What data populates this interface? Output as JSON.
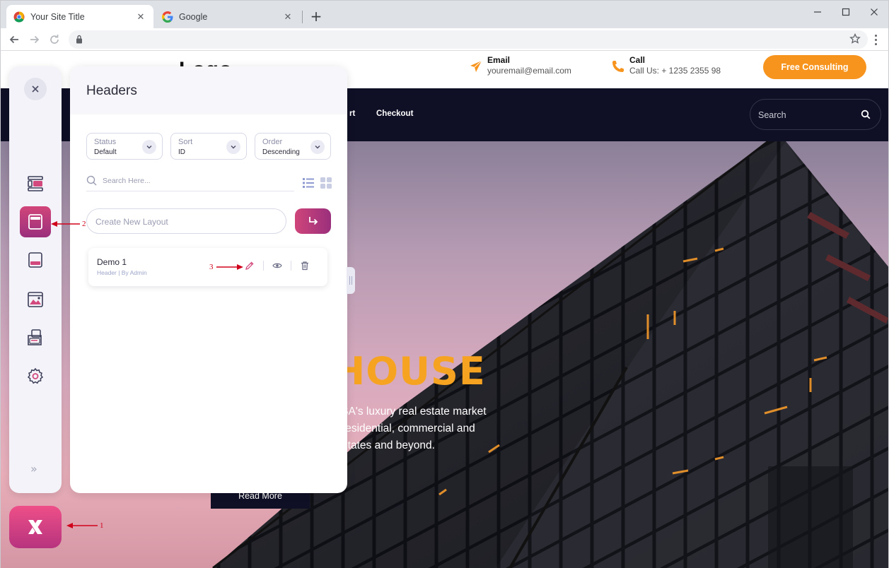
{
  "browser": {
    "tabs": [
      {
        "title": "Your Site Title",
        "active": true
      },
      {
        "title": "Google",
        "active": false
      }
    ]
  },
  "site": {
    "logo": "Logo",
    "email_label": "Email",
    "email_value": "youremail@email.com",
    "call_label": "Call",
    "call_value": "Call Us: + 1235 2355 98",
    "cta_label": "Free Consulting",
    "nav": [
      "rt",
      "Checkout"
    ],
    "search_placeholder": "Search",
    "hero": {
      "title": "HOUSE",
      "lines": [
        "USA's luxury real estate market",
        "c residential, commercial and",
        "e states and beyond."
      ],
      "read_more": "Read More"
    },
    "colors": {
      "accent": "#f7941d",
      "nav_bg": "#0f1026"
    }
  },
  "builder": {
    "panel_title": "Headers",
    "filters": [
      {
        "label": "Status",
        "value": "Default"
      },
      {
        "label": "Sort",
        "value": "ID"
      },
      {
        "label": "Order",
        "value": "Descending"
      }
    ],
    "search_placeholder": "Search Here...",
    "create_placeholder": "Create New Layout",
    "layouts": [
      {
        "title": "Demo 1",
        "meta": "Header | By Admin"
      }
    ],
    "rail_icons": [
      "close-icon",
      "sections-icon",
      "header-layout-icon",
      "footer-layout-icon",
      "gallery-icon",
      "templates-icon",
      "settings-icon",
      "expand-icon"
    ],
    "accent": "#c0407c"
  },
  "annotations": [
    "1",
    "2",
    "3"
  ]
}
